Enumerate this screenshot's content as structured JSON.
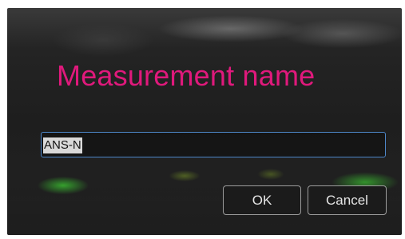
{
  "dialog": {
    "title": "Measurement name",
    "title_color": "#e0197c",
    "name_field": {
      "value": "ANS-N",
      "selected": true
    },
    "buttons": {
      "ok_label": "OK",
      "cancel_label": "Cancel"
    }
  }
}
